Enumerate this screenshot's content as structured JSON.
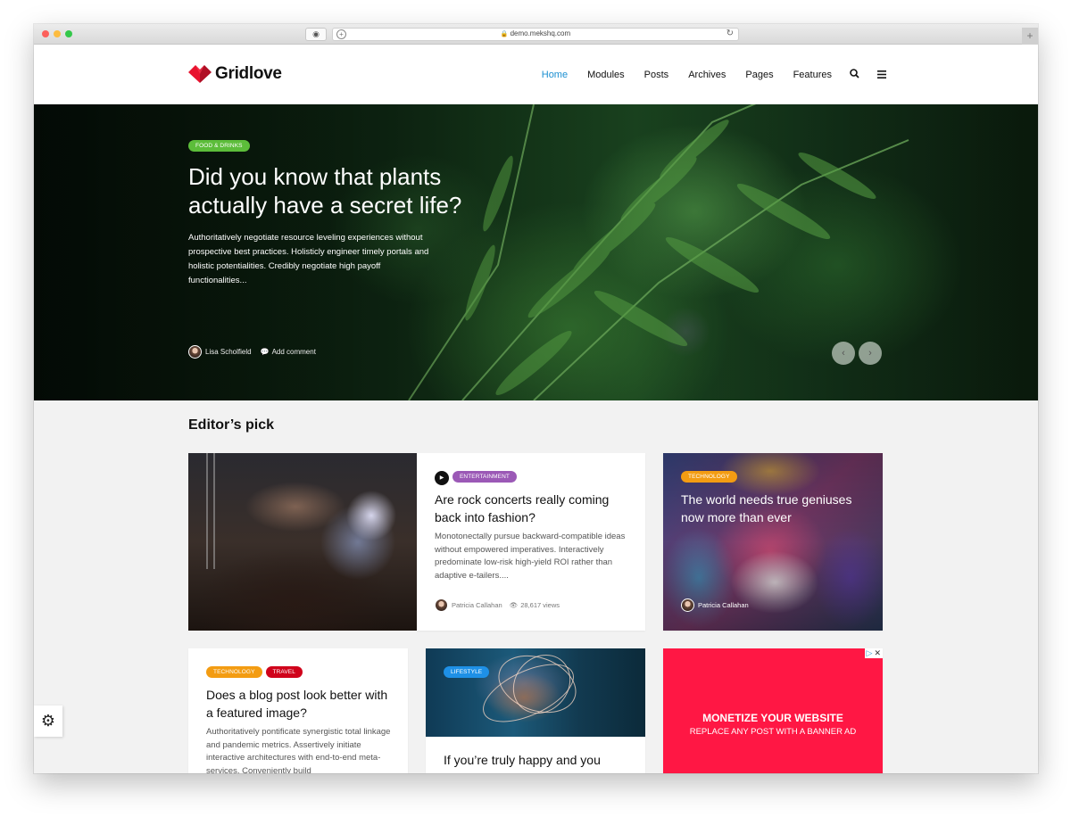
{
  "browser": {
    "url": "demo.mekshq.com"
  },
  "site": {
    "logo_text": "Gridlove",
    "brand_color": "#e8132f",
    "nav": {
      "items": [
        {
          "label": "Home",
          "active": true
        },
        {
          "label": "Modules",
          "active": false
        },
        {
          "label": "Posts",
          "active": false
        },
        {
          "label": "Archives",
          "active": false
        },
        {
          "label": "Pages",
          "active": false
        },
        {
          "label": "Features",
          "active": false
        }
      ],
      "search_icon": "search-icon",
      "menu_icon": "hamburger-icon",
      "active_color": "#1b8fd1"
    }
  },
  "hero": {
    "category": "Food & Drinks",
    "category_color": "#5cbd3a",
    "title": "Did you know that plants actually have a secret life?",
    "excerpt": "Authoritatively negotiate resource leveling experiences without prospective best practices. Holisticly engineer timely portals and holistic potentialities. Credibly negotiate high payoff functionalities...",
    "author": "Lisa Scholfield",
    "comment_label": "Add comment",
    "prev_label": "‹",
    "next_label": "›"
  },
  "editors_pick": {
    "title": "Editor’s pick",
    "cards": [
      {
        "category": "Entertainment",
        "category_color": "#9b59b6",
        "format_icon": "play-icon",
        "title": "Are rock concerts really coming back into fashion?",
        "excerpt": "Monotonectally pursue backward-compatible ideas without empowered imperatives. Interactively predominate low-risk high-yield ROI rather than adaptive e-tailers....",
        "author": "Patricia Callahan",
        "views": "28,617 views"
      },
      {
        "category": "Technology",
        "category_color": "#f39c12",
        "title": "The world needs true geniuses now more than ever",
        "author": "Patricia Callahan"
      },
      {
        "categories": [
          {
            "label": "Technology",
            "color": "#f39c12"
          },
          {
            "label": "Travel",
            "color": "#d0021b"
          }
        ],
        "title": "Does a blog post look better with a featured image?",
        "excerpt": "Authoritatively pontificate synergistic total linkage and pandemic metrics. Assertively initiate interactive architectures with end-to-end meta-services. Conveniently build"
      },
      {
        "category": "Lifestyle",
        "category_color": "#1e90e6",
        "title": "If you’re truly happy and you"
      }
    ],
    "ad": {
      "title": "MONETIZE YOUR WEBSITE",
      "subtitle": "REPLACE ANY POST WITH A BANNER AD",
      "background": "#ff1744",
      "adchoices_icon": "▷",
      "close_icon": "✕"
    }
  },
  "settings_icon": "⚙"
}
